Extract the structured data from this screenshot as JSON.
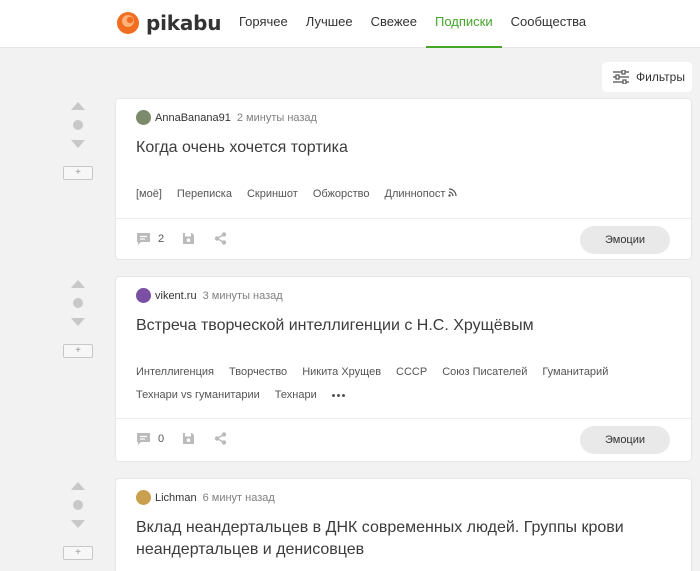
{
  "header": {
    "logo_text": "pikabu",
    "nav": [
      {
        "label": "Горячее"
      },
      {
        "label": "Лучшее"
      },
      {
        "label": "Свежее"
      },
      {
        "label": "Подписки",
        "active": true
      },
      {
        "label": "Сообщества"
      }
    ],
    "accent_color": "#44a629"
  },
  "filters": {
    "label": "Фильтры"
  },
  "posts": [
    {
      "author": "AnnaBanana91",
      "time": "2 минуты назад",
      "title": "Когда очень хочется тортика",
      "tags": [
        "[моё]",
        "Переписка",
        "Скриншот",
        "Обжорство",
        "Длиннопост"
      ],
      "long_post_icon": "rss-icon",
      "comments": "2",
      "emotions_label": "Эмоции"
    },
    {
      "author": "vikent.ru",
      "time": "3 минуты назад",
      "title": "Встреча творческой интеллигенции с Н.С. Хрущёвым",
      "tags": [
        "Интеллигенция",
        "Творчество",
        "Никита Хрущев",
        "СССР",
        "Союз Писателей",
        "Гуманитарий",
        "Технари vs гуманитарии",
        "Технари"
      ],
      "comments": "0",
      "emotions_label": "Эмоции"
    },
    {
      "author": "Lichman",
      "time": "6 минут назад",
      "title": "Вклад неандертальцев в ДНК современных людей. Группы крови неандертальцев и денисовцев"
    }
  ],
  "vote": {
    "plus_label": "+"
  }
}
